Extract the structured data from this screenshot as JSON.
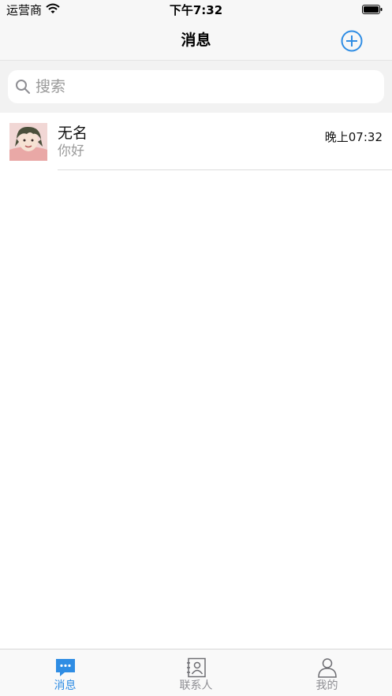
{
  "status_bar": {
    "carrier": "运营商",
    "time": "下午7:32"
  },
  "nav": {
    "title": "消息",
    "add_icon": "plus-circle-icon"
  },
  "search": {
    "placeholder": "搜索",
    "icon": "search-icon"
  },
  "conversations": [
    {
      "name": "无名",
      "last_message": "你好",
      "time": "晚上07:32",
      "avatar": "user-avatar"
    }
  ],
  "tab_bar": {
    "tabs": [
      {
        "label": "消息",
        "icon": "chat-bubble-icon",
        "active": true
      },
      {
        "label": "联系人",
        "icon": "contacts-book-icon",
        "active": false
      },
      {
        "label": "我的",
        "icon": "profile-person-icon",
        "active": false
      }
    ]
  },
  "colors": {
    "accent": "#2f8de4",
    "inactive": "#8e8e93",
    "background": "#f2f2f2"
  }
}
